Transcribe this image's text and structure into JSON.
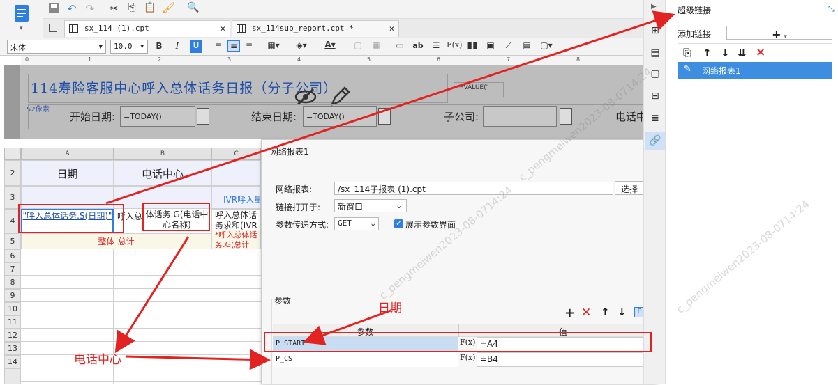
{
  "tabs": [
    {
      "label": "sx_114 (1).cpt",
      "close": "×"
    },
    {
      "label": "sx_114sub_report.cpt *",
      "close": "×"
    }
  ],
  "format_bar": {
    "font_name": "宋体",
    "font_size": "10.0"
  },
  "report": {
    "title": "114寿险客服中心呼入总体话务日报（分子公司）",
    "pixel_note": "52像素",
    "value_formula": "=VALUE(\"",
    "param_start_label": "开始日期:",
    "param_start_value": "=TODAY()",
    "param_end_label": "结束日期:",
    "param_end_value": "=TODAY()",
    "param_company_label": "子公司:",
    "param_phone_label": "电话中"
  },
  "grid": {
    "columns": [
      "A",
      "B",
      "C"
    ],
    "rows": [
      "2",
      "3",
      "4",
      "5",
      "6",
      "7",
      "8",
      "9",
      "10",
      "11",
      "12",
      "13",
      "14"
    ],
    "a2": "日期",
    "b2": "电话中心",
    "c3": "IVR呼入量",
    "a4": "\"呼入总体话务.S(日期)\"",
    "b4_prefix": "呼入总",
    "b4": "体话务.G(电话中心名称)",
    "c4": "呼入总体话务求和(IVR呼",
    "a5": "整体-总计",
    "c5": "*呼入总体话务.G(总计_IVR"
  },
  "dialog": {
    "title": "网络报表1",
    "report_label": "网络报表:",
    "report_value": "/sx_114子报表 (1).cpt",
    "choose_button": "选择",
    "open_label": "链接打开于:",
    "open_value": "新窗口",
    "method_label": "参数传递方式:",
    "method_value": "GET",
    "show_params_label": "展示参数界面",
    "params_section": "参数",
    "col_param": "参数",
    "col_value": "值",
    "params": [
      {
        "name": "P_START",
        "value": "=A4"
      },
      {
        "name": "P_CS",
        "value": "=B4"
      }
    ]
  },
  "right_panel": {
    "title": "超级链接",
    "add_label": "添加链接",
    "add_button": "+",
    "items": [
      "网络报表1"
    ]
  },
  "annotations": {
    "date_label": "日期",
    "phone_center_label": "电话中心"
  },
  "watermark": "c_pengmeiwen2023-08-0714:24",
  "accent_color": "#2f7fe0",
  "highlight_color": "#e32222"
}
